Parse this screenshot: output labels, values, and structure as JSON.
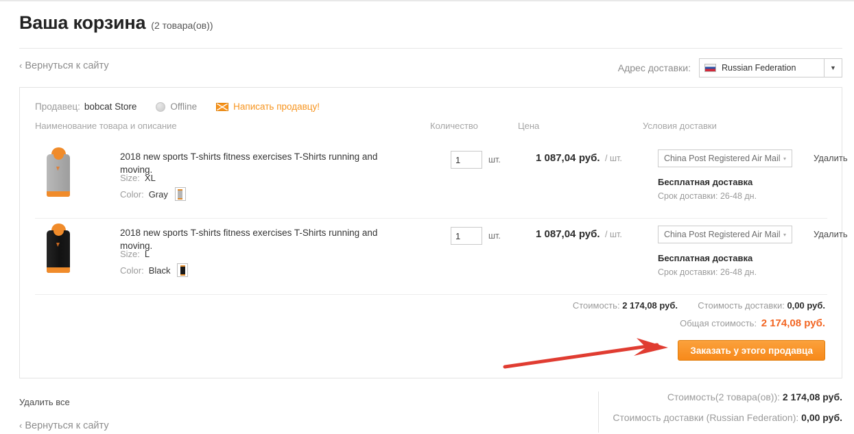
{
  "header": {
    "title": "Ваша корзина",
    "count": "(2 товара(ов))",
    "back_link": "Вернуться к сайту",
    "chevron": "‹"
  },
  "delivery_address": {
    "label": "Адрес доставки:",
    "selected_country": "Russian Federation",
    "flag_icon": "russia-flag-icon",
    "caret": "▼"
  },
  "seller": {
    "label": "Продавец:",
    "name": "bobcat Store",
    "status": "Offline",
    "status_icon": "offline-dot-icon",
    "message_link": "Написать продавцу!",
    "message_icon": "envelope-icon"
  },
  "columns": {
    "name": "Наименование товара и описание",
    "qty": "Количество",
    "price": "Цена",
    "shipping": "Условия доставки"
  },
  "items": [
    {
      "thumb_icon": "gray-hooded-tank-top",
      "name": "2018 new sports T-shirts fitness exercises T-Shirts running and moving.",
      "size_label": "Size:",
      "size_value": "XL",
      "color_label": "Color:",
      "color_value": "Gray",
      "swatch_icon": "gray-color-swatch",
      "qty": "1",
      "qty_unit": "шт.",
      "price": "1 087,04",
      "currency": "руб.",
      "price_per": "/ шт.",
      "shipping_method": "China Post Registered Air Mail",
      "shipping_caret": "▾",
      "shipping_free": "Бесплатная доставка",
      "shipping_time": "Срок доставки: 26-48 дн.",
      "delete_label": "Удалить"
    },
    {
      "thumb_icon": "black-hooded-tank-top",
      "name": "2018 new sports T-shirts fitness exercises T-Shirts running and moving.",
      "size_label": "Size:",
      "size_value": "L",
      "color_label": "Color:",
      "color_value": "Black",
      "swatch_icon": "black-color-swatch",
      "qty": "1",
      "qty_unit": "шт.",
      "price": "1 087,04",
      "currency": "руб.",
      "price_per": "/ шт.",
      "shipping_method": "China Post Registered Air Mail",
      "shipping_caret": "▾",
      "shipping_free": "Бесплатная доставка",
      "shipping_time": "Срок доставки: 26-48 дн.",
      "delete_label": "Удалить"
    }
  ],
  "seller_totals": {
    "cost_label": "Стоимость:",
    "cost_value": "2 174,08 руб.",
    "shipping_label": "Стоимость доставки:",
    "shipping_value": "0,00 руб.",
    "grand_label": "Общая стоимость:",
    "grand_value": "2 174,08 руб.",
    "order_button": "Заказать у этого продавца"
  },
  "annotation": {
    "arrow_color": "#e03c31",
    "arrow_name": "red-pointer-arrow"
  },
  "footer": {
    "delete_all": "Удалить все",
    "back_link": "Вернуться к сайту",
    "chevron": "‹",
    "summary": [
      {
        "label": "Стоимость(2 товара(ов)):",
        "value": "2 174,08 руб."
      },
      {
        "label": "Стоимость доставки (Russian Federation):",
        "value": "0,00 руб."
      }
    ]
  },
  "colors": {
    "accent_orange": "#f7941e",
    "total_orange": "#f26522",
    "muted_gray": "#9a9a9a",
    "border": "#e3e3e3"
  }
}
